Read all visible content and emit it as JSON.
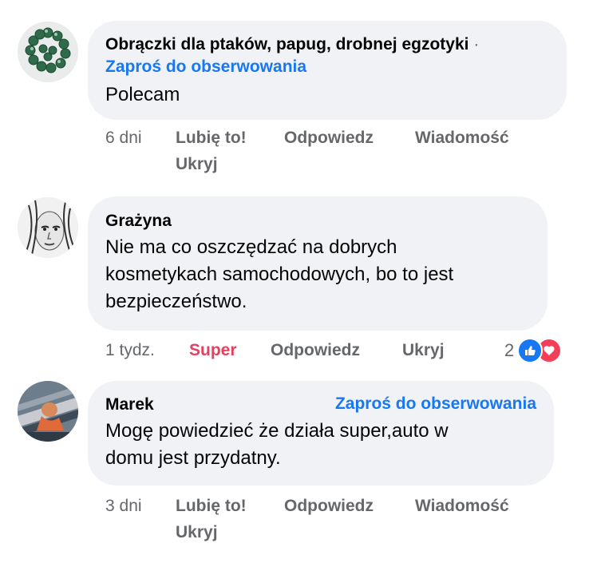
{
  "comments": [
    {
      "author": "Obrączki dla ptaków, papug, drobnej egzotyki",
      "separator": "·",
      "follow_label": "Zaproś do obserwowania",
      "text": "Polecam",
      "time": "6 dni",
      "like_label": "Lubię to!",
      "reply_label": "Odpowiedz",
      "message_label": "Wiadomość",
      "hide_label": "Ukryj",
      "avatar_icon": "bead-ring-avatar"
    },
    {
      "author": "Grażyna",
      "text_lines": [
        "Nie ma co oszczędzać na dobrych",
        "kosmetykach samochodowych, bo to jest",
        "bezpieczeństwo."
      ],
      "time": "1 tydz.",
      "reaction_label": "Super",
      "reaction_color": "#e4405f",
      "reply_label": "Odpowiedz",
      "hide_label": "Ukryj",
      "reaction_count": "2",
      "reaction_icons": [
        "like-icon",
        "heart-icon"
      ],
      "avatar_icon": "sketch-portrait-avatar"
    },
    {
      "author": "Marek",
      "follow_label": "Zaproś do obserwowania",
      "text_lines": [
        "Mogę powiedzieć że działa super,auto w",
        "domu jest przydatny."
      ],
      "time": "3 dni",
      "like_label": "Lubię to!",
      "reply_label": "Odpowiedz",
      "message_label": "Wiadomość",
      "hide_label": "Ukryj",
      "avatar_icon": "photo-avatar"
    }
  ],
  "colors": {
    "link": "#1877f2",
    "bubble": "#f0f2f5",
    "secondary": "#65676b",
    "love": "#f33e58"
  }
}
